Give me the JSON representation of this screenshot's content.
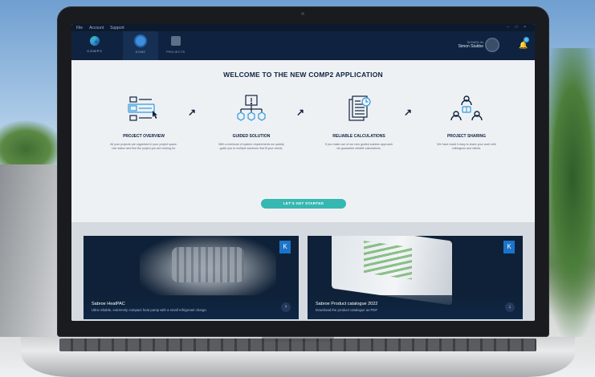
{
  "menu": [
    "File",
    "Account",
    "Support"
  ],
  "window_controls": "– □ ×",
  "app": {
    "logo_text": "COMP2"
  },
  "nav": [
    {
      "label": "HOME",
      "active": true
    },
    {
      "label": "PROJECTS",
      "active": false
    }
  ],
  "user": {
    "caption": "SIGNED IN",
    "name": "Simon Stubbe"
  },
  "notifications": {
    "count": "0"
  },
  "welcome_title": "WELCOME TO THE NEW COMP2 APPLICATION",
  "features": [
    {
      "title": "PROJECT OVERVIEW",
      "icon": "folders-icon",
      "desc": "All your projects are organised in your project space. Use status and find the project you are looking for."
    },
    {
      "title": "GUIDED SOLUTION",
      "icon": "decision-tree-icon",
      "desc": "With a minimum of system requirements we quickly guide you to multiple solutions that fit your needs."
    },
    {
      "title": "RELIABLE CALCULATIONS",
      "icon": "documents-icon",
      "desc": "If you make use of our new guided solution approach we guarantee reliable calculations."
    },
    {
      "title": "PROJECT SHARING",
      "icon": "share-users-icon",
      "desc": "We have made it easy to share your work with colleagues and clients."
    }
  ],
  "cta_label": "LET'S GET STARTED",
  "cards": [
    {
      "title": "Sabroe HeatPAC",
      "subtitle": "Ultra reliable, extremely compact heat pump with a small refrigerant charge.",
      "brand": "K"
    },
    {
      "title": "Sabroe Product catalogue 2022",
      "subtitle": "Download the product catalogue as PDF",
      "brand": "K"
    }
  ],
  "colors": {
    "navy": "#0f2340",
    "accent": "#35b8b1",
    "home_icon": "#3e8ddf"
  }
}
